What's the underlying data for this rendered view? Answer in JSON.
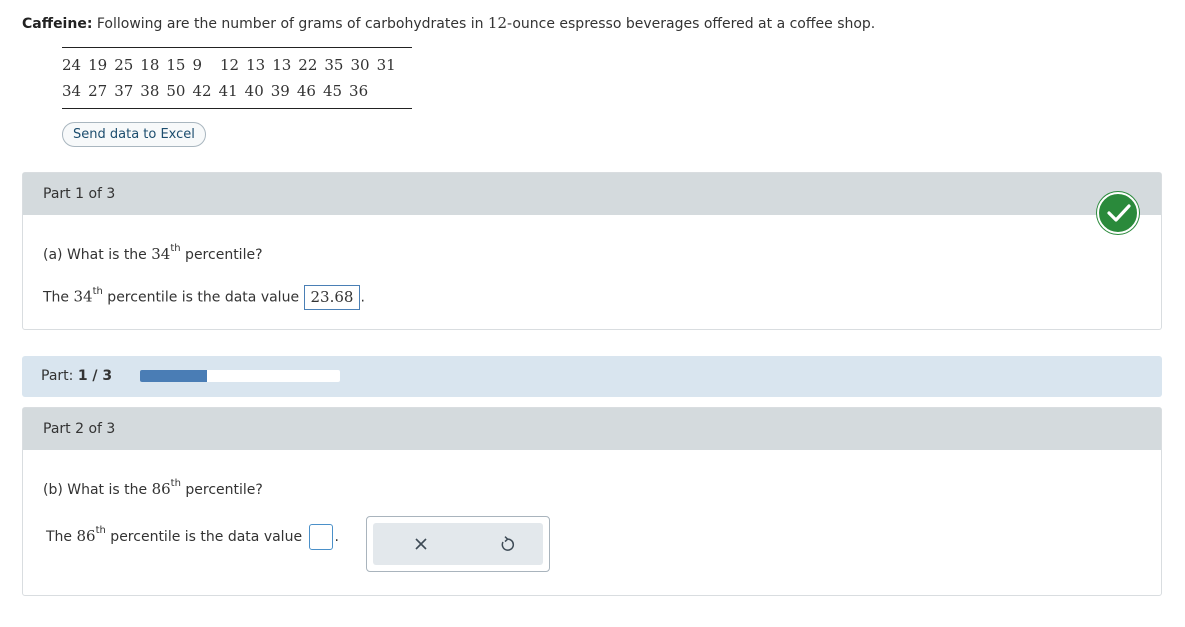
{
  "problem": {
    "title": "Caffeine:",
    "text_before": " Following are the number of grams of carbohydrates in ",
    "number": "12",
    "text_after": "-ounce espresso beverages offered at a coffee shop."
  },
  "data_rows": [
    [
      "24",
      "19",
      "25",
      "18",
      "15",
      "9",
      "12",
      "13",
      "13",
      "22",
      "35",
      "30",
      "31"
    ],
    [
      "34",
      "27",
      "37",
      "38",
      "50",
      "42",
      "41",
      "40",
      "39",
      "46",
      "45",
      "36"
    ]
  ],
  "excel_button": "Send data to Excel",
  "part1": {
    "header": "Part 1 of 3",
    "question_prefix": "(a) What is the ",
    "percentile": "34",
    "sup": "th",
    "question_suffix": " percentile?",
    "answer_prefix": "The ",
    "answer_middle": " percentile is the data value ",
    "answer_value": "23.68",
    "answer_end": "."
  },
  "progress": {
    "label": "Part: ",
    "current": "1 / 3",
    "fraction": 0.333
  },
  "part2": {
    "header": "Part 2 of 3",
    "question_prefix": "(b) What is the ",
    "percentile": "86",
    "sup": "th",
    "question_suffix": " percentile?",
    "answer_prefix": "The ",
    "answer_middle": " percentile is the data value ",
    "answer_end": "."
  },
  "icons": {
    "correct": "checkmark-icon",
    "clear": "x-icon",
    "undo": "undo-icon"
  },
  "colors": {
    "correct_green": "#2a8a3b",
    "progress_fill": "#4a7db5",
    "header_gray": "#d4dadd",
    "strip_blue": "#d9e5ef"
  }
}
